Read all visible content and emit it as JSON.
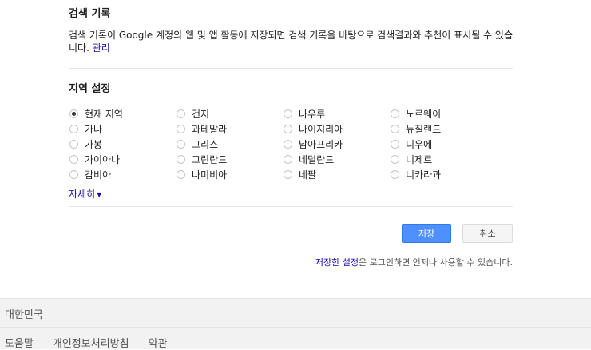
{
  "history": {
    "title": "검색 기록",
    "desc": "검색 기록이 Google 계정의 웹 및 앱 활동에 저장되면 검색 기록을 바탕으로 검색결과와 추천이 표시될 수 있습니다.",
    "manage_link": "관리"
  },
  "region": {
    "title": "지역 설정",
    "selected": "현재 지역",
    "columns": [
      [
        "현재 지역",
        "가나",
        "가봉",
        "가이아나",
        "감비아"
      ],
      [
        "건지",
        "과테말라",
        "그리스",
        "그린란드",
        "나미비아"
      ],
      [
        "나우루",
        "나이지리아",
        "남아프리카",
        "네덜란드",
        "네팔"
      ],
      [
        "노르웨이",
        "뉴질랜드",
        "니우에",
        "니제르",
        "니카라과"
      ]
    ],
    "more_label": "자세히"
  },
  "actions": {
    "save_label": "저장",
    "cancel_label": "취소"
  },
  "saved_note": {
    "link": "저장한 설정",
    "text": "은 로그인하면 언제나 사용할 수 있습니다."
  },
  "footer": {
    "country": "대한민국",
    "links": [
      "도움말",
      "개인정보처리방침",
      "약관"
    ]
  }
}
